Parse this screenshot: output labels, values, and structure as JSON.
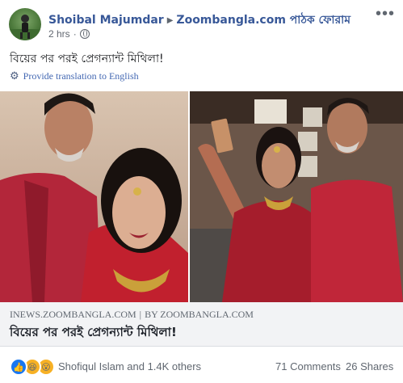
{
  "header": {
    "author": "Shoibal Majumdar",
    "group": "Zoombangla.com পাঠক ফোরাম",
    "time": "2 hrs",
    "separator": "·",
    "more_icon": "more-horizontal-icon"
  },
  "post": {
    "text": "বিয়ের পর পরই প্রেগন্যান্ট মিথিলা!",
    "translate_label": "Provide translation to English"
  },
  "preview": {
    "domain": "INEWS.ZOOMBANGLA.COM",
    "divider": "|",
    "by_label": "BY ZOOMBANGLA.COM",
    "title": "বিয়ের পর পরই প্রেগন্যান্ট মিথিলা!"
  },
  "footer": {
    "reactors": "Shofiqul Islam and 1.4K others",
    "comments": "71 Comments",
    "shares": "26 Shares"
  },
  "colors": {
    "link_blue": "#385898",
    "reaction_like": "#1877f2",
    "reaction_emoji": "#f7b125",
    "preview_bg": "#f2f3f5"
  }
}
